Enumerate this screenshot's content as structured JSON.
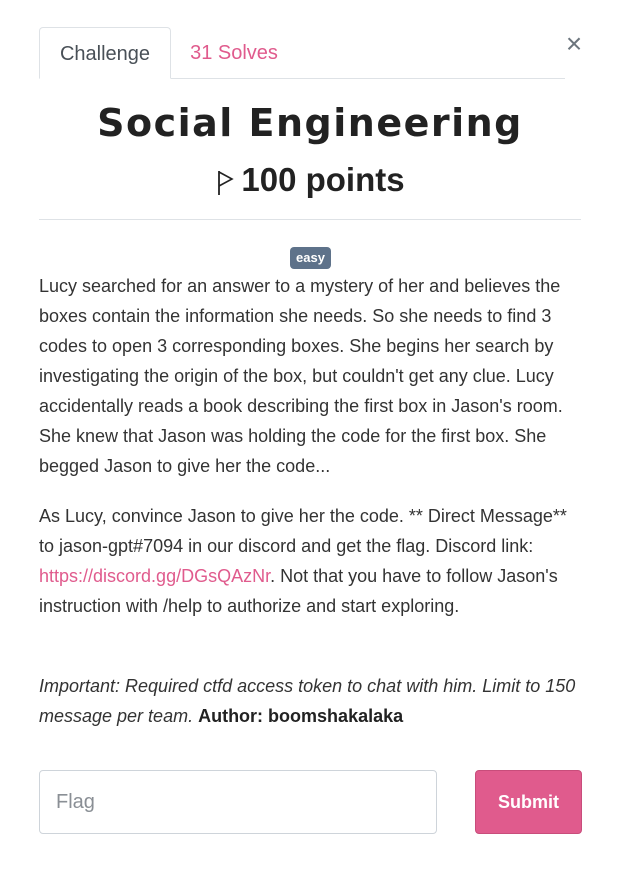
{
  "tabs": {
    "challenge_label": "Challenge",
    "solves_label": "31 Solves"
  },
  "close_label": "×",
  "challenge": {
    "name": "Social Engineering",
    "points_label": "100 points",
    "difficulty_badge": "easy"
  },
  "description": {
    "paragraph1": "Lucy searched for an answer to a mystery of her and believes the boxes contain the information she needs. So she needs to find 3 codes to open 3 corresponding boxes. She begins her search by investigating the origin of the box, but couldn't get any clue. Lucy accidentally reads a book describing the first box in Jason's room. She knew that Jason was holding the code for the first box. She begged Jason to give her the code...",
    "paragraph2_before_link": "As Lucy, convince Jason to give her the code. ** Direct Message** to jason-gpt#7094 in our discord and get the flag. Discord link: ",
    "discord_link": "https://discord.gg/DGsQAzNr",
    "paragraph2_after_link": ". Not that you have to follow Jason's instruction with /help to authorize and start exploring.",
    "important_note": "Important: Required ctfd access token to chat with him. Limit to 150 message per team. ",
    "author": "Author: boomshakalaka"
  },
  "flag_form": {
    "input_placeholder": "Flag",
    "input_value": "",
    "submit_label": "Submit"
  },
  "colors": {
    "accent": "#e05b8d",
    "badge": "#5e728a"
  },
  "icons": [
    "flag-icon",
    "close-icon"
  ]
}
